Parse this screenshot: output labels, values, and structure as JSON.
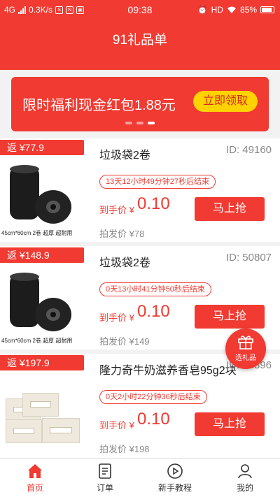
{
  "status_bar": {
    "network": "4G",
    "speed": "0.3K/s",
    "time": "09:38",
    "hd": "HD",
    "battery": "85%"
  },
  "header": {
    "title": "91礼品单"
  },
  "banner": {
    "text": "限时福利现金红包1.88元",
    "button": "立即领取",
    "dots": 3,
    "active_dot": 2
  },
  "products": [
    {
      "rebate": "返 ¥77.9",
      "title": "垃圾袋2卷",
      "id": "ID:  49160",
      "timer": "13天12小时49分钟27秒后结束",
      "price_label": "到手价 ¥",
      "price": "0.10",
      "button": "马上抢",
      "original": "拍发价 ¥78",
      "caption": "45cm*60cm 2卷 超厚 超耐用"
    },
    {
      "rebate": "返 ¥148.9",
      "title": "垃圾袋2卷",
      "id": "ID:  50807",
      "timer": "0天13小时41分钟50秒后结束",
      "price_label": "到手价 ¥",
      "price": "0.10",
      "button": "马上抢",
      "original": "拍发价 ¥149",
      "caption": "45cm*60cm 2卷 超厚 超耐用"
    },
    {
      "rebate": "返 ¥197.9",
      "title": "隆力奇牛奶滋养香皂95g2块",
      "id": "ID:  50896",
      "timer": "0天2小时22分钟36秒后结束",
      "price_label": "到手价 ¥",
      "price": "0.10",
      "button": "马上抢",
      "original": "拍发价 ¥198",
      "caption": ""
    }
  ],
  "fab": {
    "label": "选礼品",
    "icon": "gift-icon"
  },
  "tabs": [
    {
      "label": "首页",
      "icon": "home-icon",
      "active": true
    },
    {
      "label": "订单",
      "icon": "order-icon",
      "active": false
    },
    {
      "label": "新手教程",
      "icon": "play-icon",
      "active": false
    },
    {
      "label": "我的",
      "icon": "user-icon",
      "active": false
    }
  ],
  "colors": {
    "brand_red": "#f03a32",
    "button_yellow": "#ffd200"
  }
}
